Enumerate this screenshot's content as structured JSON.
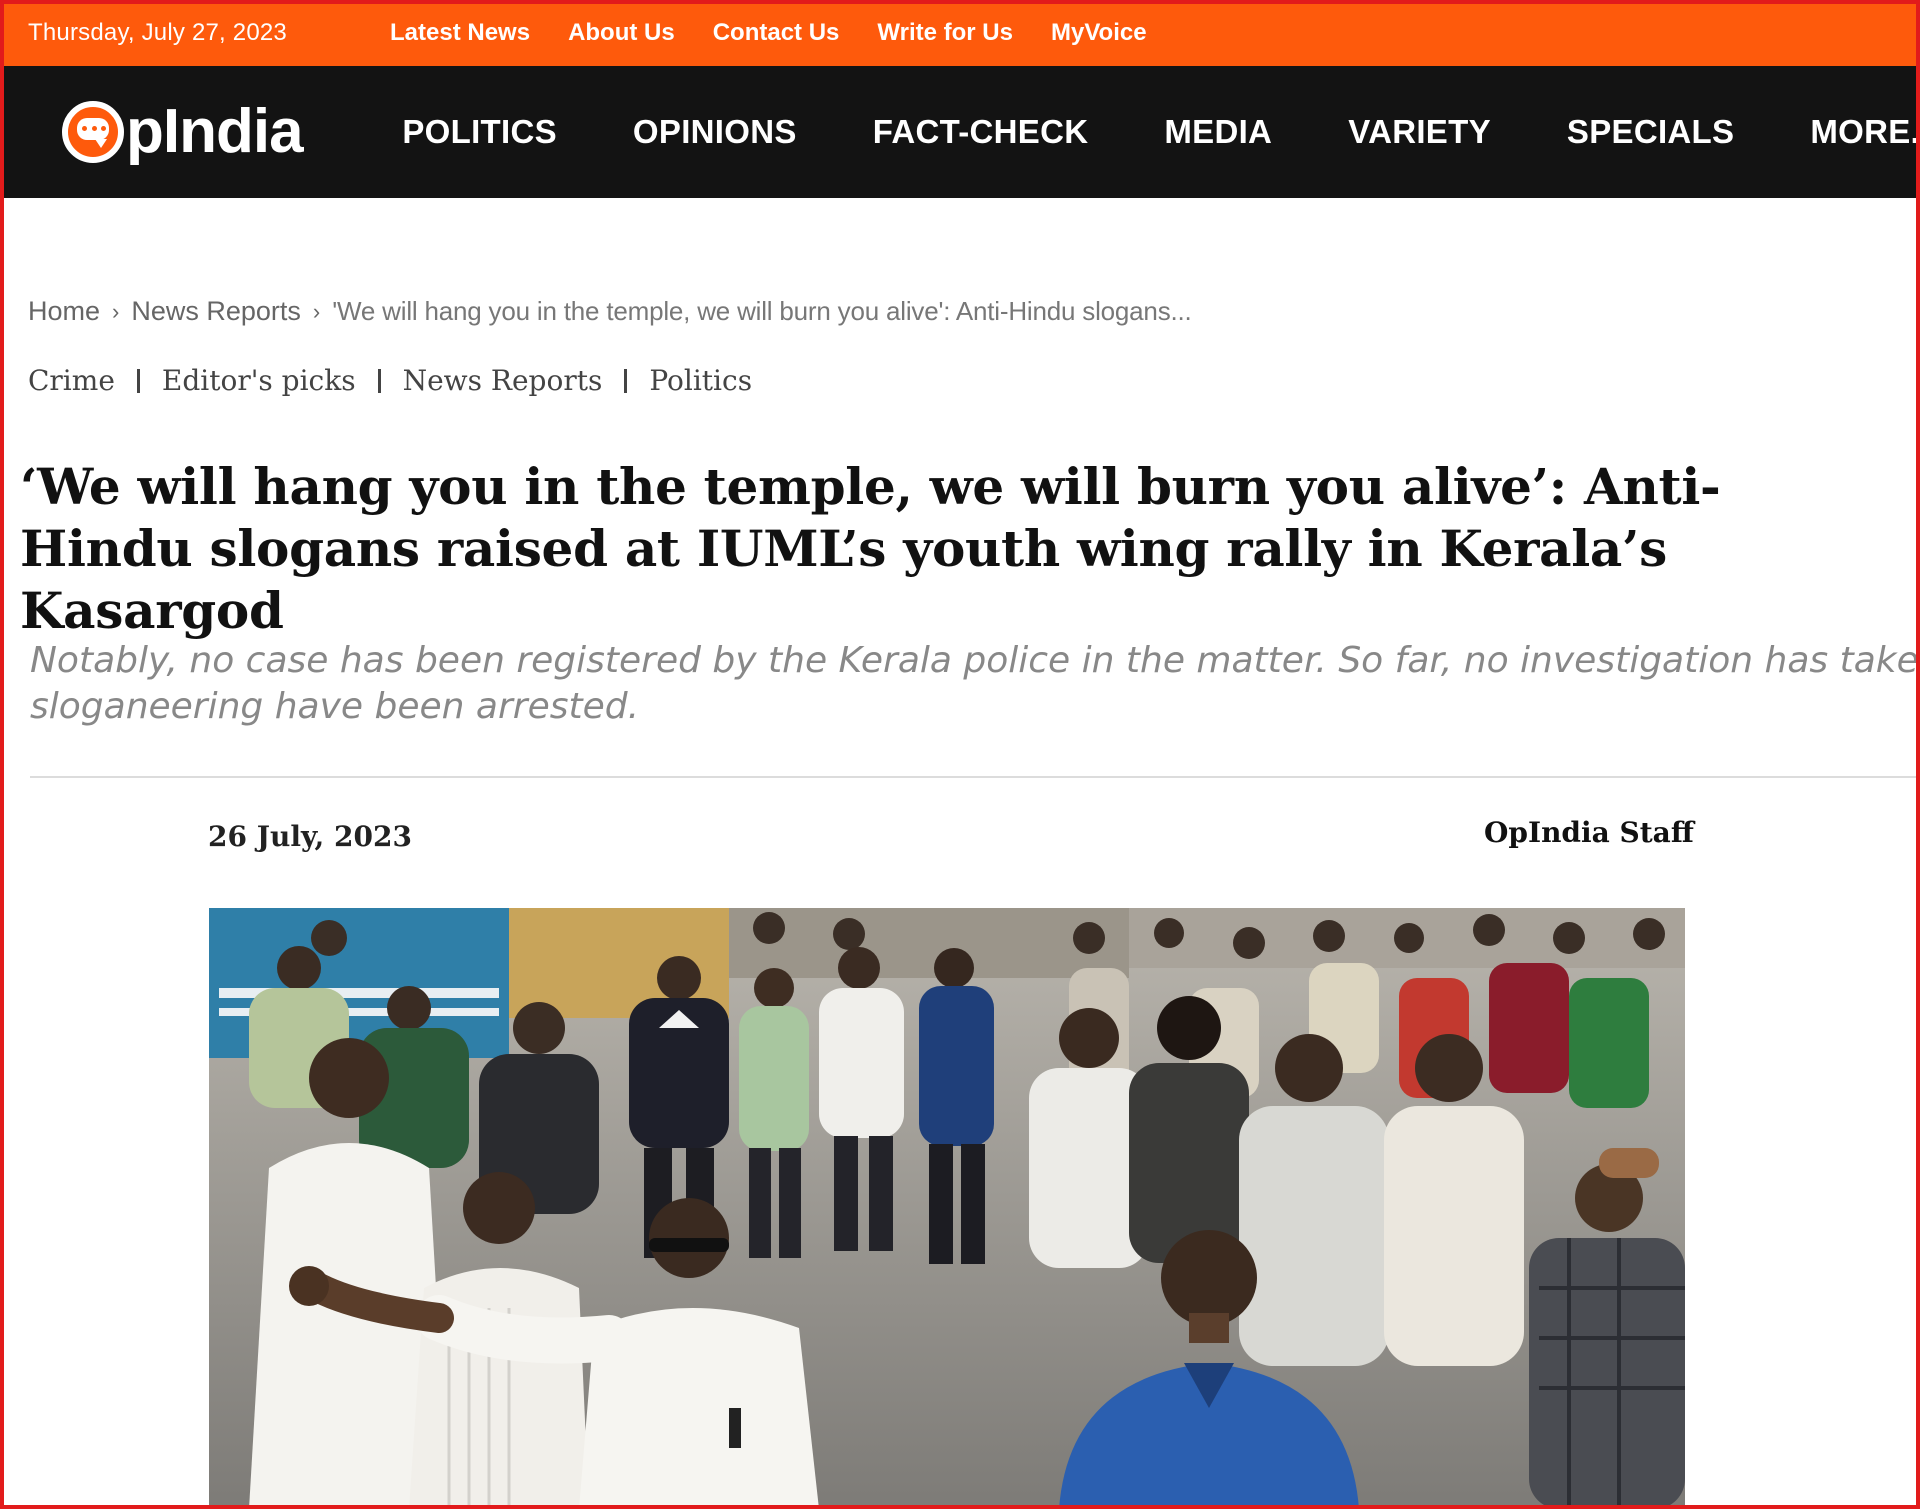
{
  "topbar": {
    "date": "Thursday, July 27, 2023",
    "links": [
      "Latest News",
      "About Us",
      "Contact Us",
      "Write for Us",
      "MyVoice"
    ]
  },
  "brand": {
    "logo_text": "pIndia",
    "accent_color": "#fe5a0c"
  },
  "nav": {
    "items": [
      "POLITICS",
      "OPINIONS",
      "FACT-CHECK",
      "MEDIA",
      "VARIETY",
      "SPECIALS",
      "MORE."
    ]
  },
  "breadcrumb": {
    "home": "Home",
    "section": "News Reports",
    "current": "'We will hang you in the temple, we will burn you alive': Anti-Hindu slogans..."
  },
  "categories": [
    "Crime",
    "Editor's picks",
    "News Reports",
    "Politics"
  ],
  "article": {
    "headline": "‘We will hang you in the temple, we will burn you alive’: Anti-Hindu slogans raised at IUML’s youth wing rally in Kerala’s Kasargod",
    "excerpt_line1": "Notably, no case has been registered by the Kerala police in the matter. So far, no investigation has taken pl",
    "excerpt_line2": "sloganeering have been arrested.",
    "date": "26 July, 2023",
    "author": "OpIndia Staff"
  }
}
